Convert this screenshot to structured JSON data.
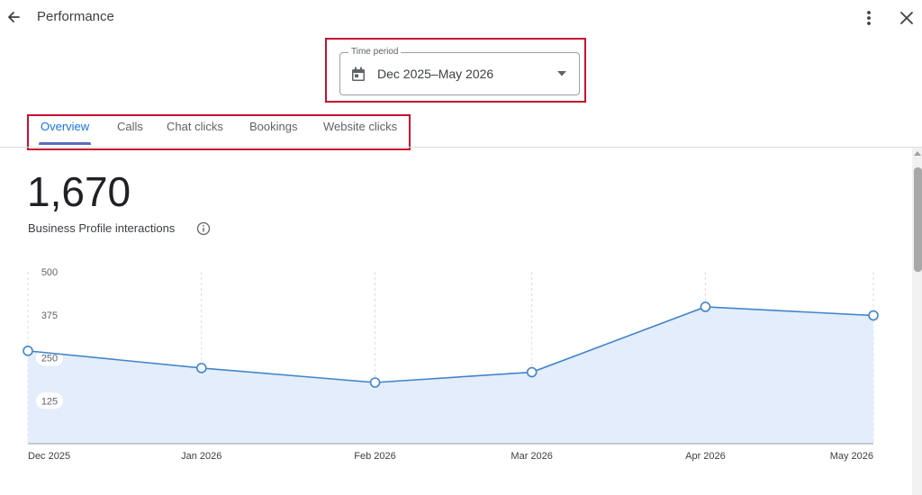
{
  "header": {
    "title": "Performance",
    "back_icon": "arrow-back-icon",
    "more_icon": "more-vert-icon",
    "close_icon": "close-icon"
  },
  "time_period": {
    "label": "Time period",
    "value": "Dec 2025–May 2026",
    "icon": "calendar-icon"
  },
  "tabs": [
    {
      "label": "Overview",
      "active": true
    },
    {
      "label": "Calls",
      "active": false
    },
    {
      "label": "Chat clicks",
      "active": false
    },
    {
      "label": "Bookings",
      "active": false
    },
    {
      "label": "Website clicks",
      "active": false
    }
  ],
  "summary": {
    "total": "1,670",
    "label": "Business Profile interactions"
  },
  "colors": {
    "accent": "#1a73e8",
    "line": "#4285c8",
    "area": "#e3edfb",
    "highlight": "#c8102e"
  },
  "chart_data": {
    "type": "area",
    "x": [
      "Dec 2025",
      "Jan 2026",
      "Feb 2026",
      "Mar 2026",
      "Apr 2026",
      "May 2026"
    ],
    "x_dates": [
      "2025-12-01",
      "2026-01-01",
      "2026-02-01",
      "2026-03-01",
      "2026-04-01",
      "2026-05-01"
    ],
    "values": [
      270,
      220,
      178,
      208,
      398,
      373
    ],
    "yticks": [
      "500",
      "375",
      "250",
      "125"
    ],
    "ylim": [
      0,
      500
    ],
    "grid": "vertical-dashed"
  }
}
